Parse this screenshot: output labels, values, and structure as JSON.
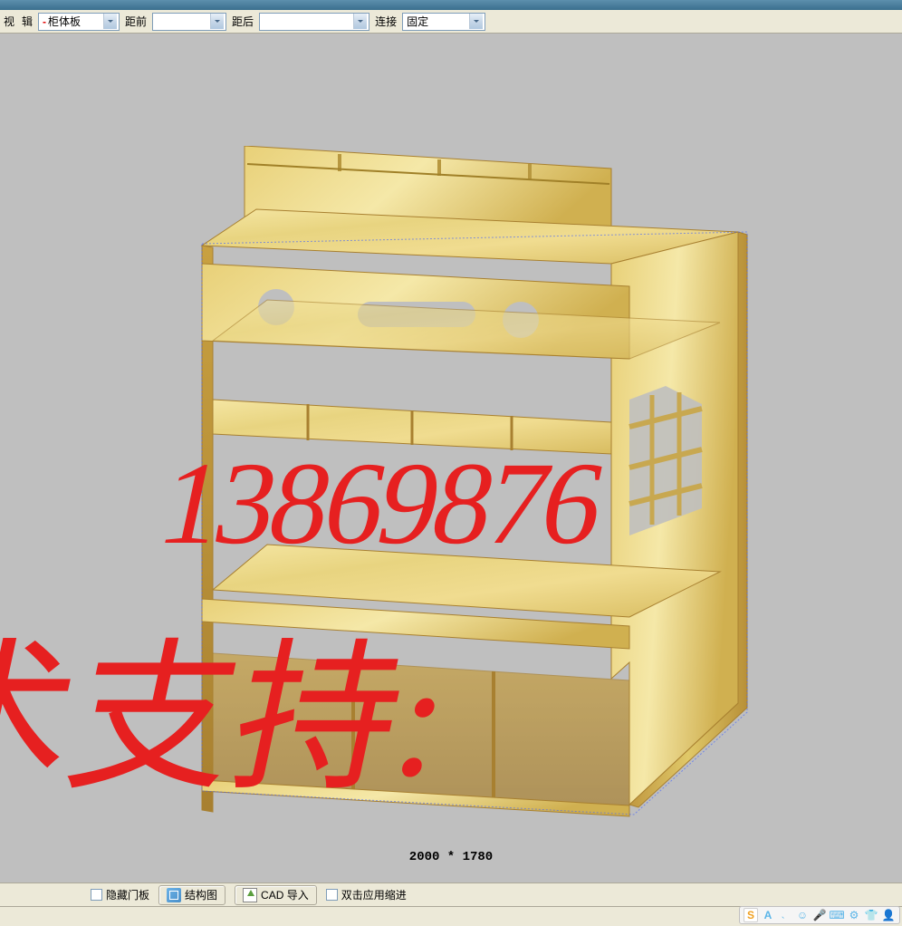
{
  "toolbar": {
    "partial_menu": "辑",
    "view_label": "视",
    "panel_type_label": "柜体板",
    "front_label": "距前",
    "front_value": "",
    "back_label": "距后",
    "back_value": "",
    "connect_label": "连接",
    "connect_value": "固定"
  },
  "canvas": {
    "dimensions": "2000 * 1780"
  },
  "watermark": {
    "phone": "13869876",
    "text": "术支持:"
  },
  "bottom_bar": {
    "hide_door_label": "隐藏门板",
    "structure_btn": "结构图",
    "cad_btn": "CAD 导入",
    "dblclick_label": "双击应用缩进"
  },
  "tray": {
    "s": "S",
    "a": "A"
  }
}
